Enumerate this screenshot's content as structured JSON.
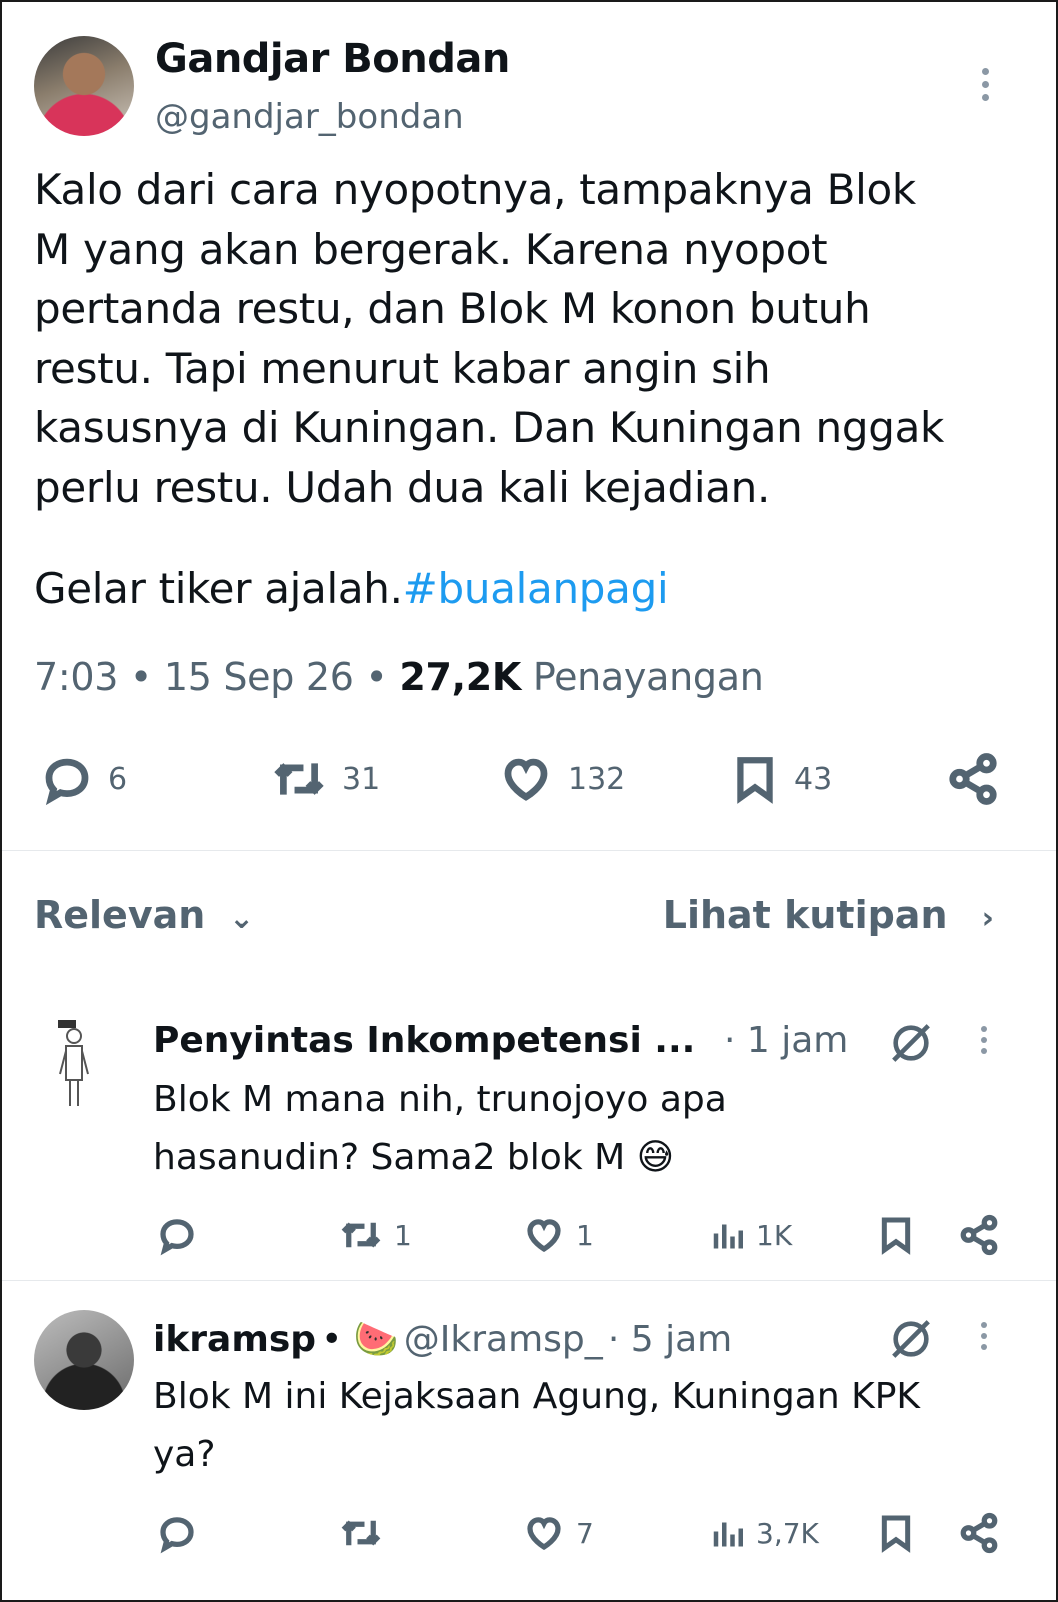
{
  "tweet": {
    "author_name": "Gandjar Bondan",
    "author_handle": "@gandjar_bondan",
    "text": "Kalo dari cara nyopotnya, tampaknya Blok\nM yang akan bergerak. Karena nyopot\npertanda restu, dan Blok M konon butuh\nrestu. Tapi menurut kabar angin sih\nkasusnya di Kuningan. Dan Kuningan nggak\nperlu restu. Udah dua kali kejadian.",
    "text2": "Gelar tiker ajalah.",
    "hashtag": "#bualanpagi",
    "time": "7:03",
    "date": "15 Sep 26",
    "views_count": "27,2K",
    "views_label": "Penayangan",
    "replies": "6",
    "retweets": "31",
    "likes": "132",
    "bookmarks": "43"
  },
  "filters": {
    "sort_label": "Relevan",
    "quotes_label": "Lihat kutipan"
  },
  "replies": [
    {
      "name": "Penyintas Inkompetensi ...",
      "time": "· 1 jam",
      "text": "Blok M mana nih, trunojoyo apa\nhasanudin? Sama2 blok M 😅",
      "retweets": "1",
      "likes": "1",
      "views": "1K"
    },
    {
      "name": "ikramsp",
      "emoji": "• 🍉",
      "handle": "@Ikramsp_",
      "time": "· 5 jam",
      "text": "Blok M ini Kejaksaan Agung, Kuningan KPK\nya?",
      "likes": "7",
      "views": "3,7K"
    }
  ],
  "colors": {
    "text": "#0f1419",
    "secondary": "#536471",
    "link": "#1d9bf0"
  }
}
